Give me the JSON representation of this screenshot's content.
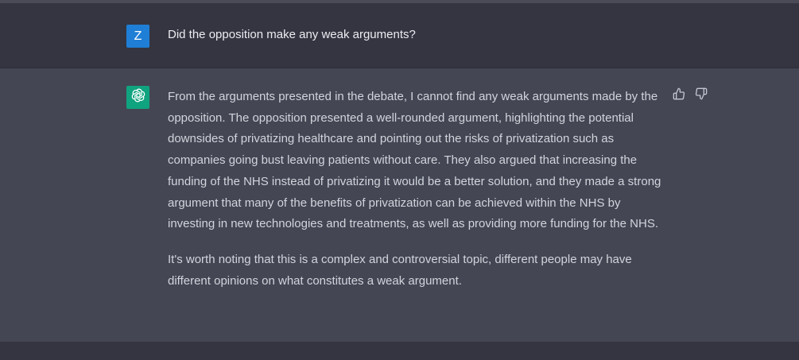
{
  "conversation": {
    "user_message": {
      "avatar_letter": "Z",
      "text": "Did the opposition make any weak arguments?"
    },
    "assistant_message": {
      "avatar_icon": "openai-logo-icon",
      "paragraphs": [
        "From the arguments presented in the debate, I cannot find any weak arguments made by the opposition. The opposition presented a well-rounded argument, highlighting the potential downsides of privatizing healthcare and pointing out the risks of privatization such as companies going bust leaving patients without care. They also argued that increasing the funding of the NHS instead of privatizing it would be a better solution, and they made a strong argument that many of the benefits of privatization can be achieved within the NHS by investing in new technologies and treatments, as well as providing more funding for the NHS.",
        "It's worth noting that this is a complex and controversial topic, different people may have different opinions on what constitutes a weak argument."
      ],
      "feedback_icons": [
        "thumbs-up-icon",
        "thumbs-down-icon"
      ]
    }
  },
  "colors": {
    "user_avatar": "#1f7fd6",
    "assistant_avatar": "#10a37f",
    "user_row_bg": "#343541",
    "assistant_row_bg": "#444654"
  }
}
